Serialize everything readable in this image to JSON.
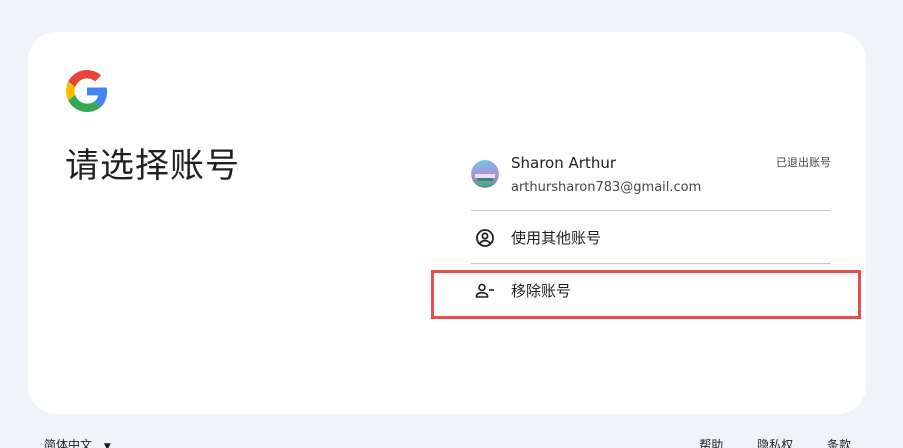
{
  "title": "请选择账号",
  "logo": {
    "icon": "google-g-logo",
    "colors": [
      "#4285F4",
      "#EA4335",
      "#FBBC05",
      "#34A853"
    ]
  },
  "account": {
    "name": "Sharon Arthur",
    "email": "arthursharon783@gmail.com",
    "status": "已退出账号",
    "avatar_icon": "profile-photo"
  },
  "options": {
    "use_other": {
      "label": "使用其他账号",
      "icon": "account-circle-icon"
    },
    "remove": {
      "label": "移除账号",
      "icon": "person-remove-icon"
    }
  },
  "highlight": {
    "color": "#e84c4c"
  },
  "footer": {
    "language": "简体中文",
    "links": [
      "帮助",
      "隐私权",
      "条款"
    ]
  }
}
